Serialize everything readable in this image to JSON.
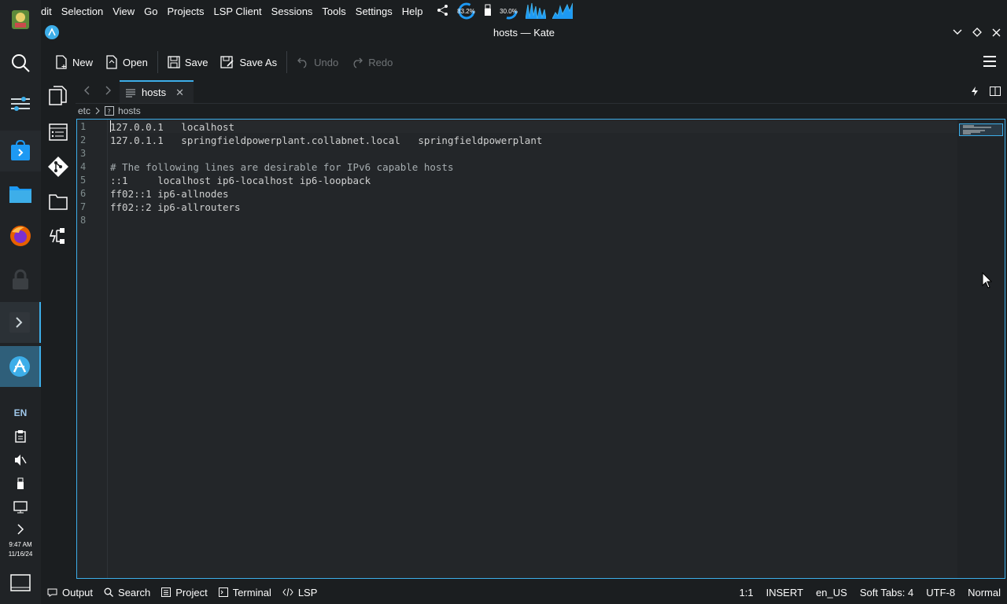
{
  "menubar": {
    "items": [
      "dit",
      "Selection",
      "View",
      "Go",
      "Projects",
      "LSP Client",
      "Sessions",
      "Tools",
      "Settings",
      "Help"
    ],
    "tray": {
      "gauge1": "83.2%",
      "gauge2": "30.0%"
    }
  },
  "window": {
    "title": "hosts — Kate"
  },
  "toolbar": {
    "new_label": "New",
    "open_label": "Open",
    "save_label": "Save",
    "save_as_label": "Save As",
    "undo_label": "Undo",
    "redo_label": "Redo"
  },
  "tabs": [
    {
      "label": "hosts",
      "active": true
    }
  ],
  "breadcrumb": {
    "folder": "etc",
    "file": "hosts"
  },
  "editor": {
    "lines": [
      {
        "n": "1",
        "text": "127.0.0.1   localhost"
      },
      {
        "n": "2",
        "text": "127.0.1.1   springfieldpowerplant.collabnet.local   springfieldpowerplant"
      },
      {
        "n": "3",
        "text": ""
      },
      {
        "n": "4",
        "text": "# The following lines are desirable for IPv6 capable hosts"
      },
      {
        "n": "5",
        "text": "::1     localhost ip6-localhost ip6-loopback"
      },
      {
        "n": "6",
        "text": "ff02::1 ip6-allnodes"
      },
      {
        "n": "7",
        "text": "ff02::2 ip6-allrouters"
      },
      {
        "n": "8",
        "text": ""
      }
    ]
  },
  "bottom_tools": {
    "output": "Output",
    "search": "Search",
    "project": "Project",
    "terminal": "Terminal",
    "lsp": "LSP"
  },
  "status": {
    "cursor": "1:1",
    "mode": "INSERT",
    "language": "en_US",
    "indent": "Soft Tabs: 4",
    "encoding": "UTF-8",
    "input_mode": "Normal"
  },
  "panel": {
    "keyboard_layout": "EN",
    "time": "9:47 AM",
    "date": "11/16/24"
  },
  "colors": {
    "accent": "#3daee9",
    "background": "#1b1e20",
    "editor_bg": "#232629"
  }
}
